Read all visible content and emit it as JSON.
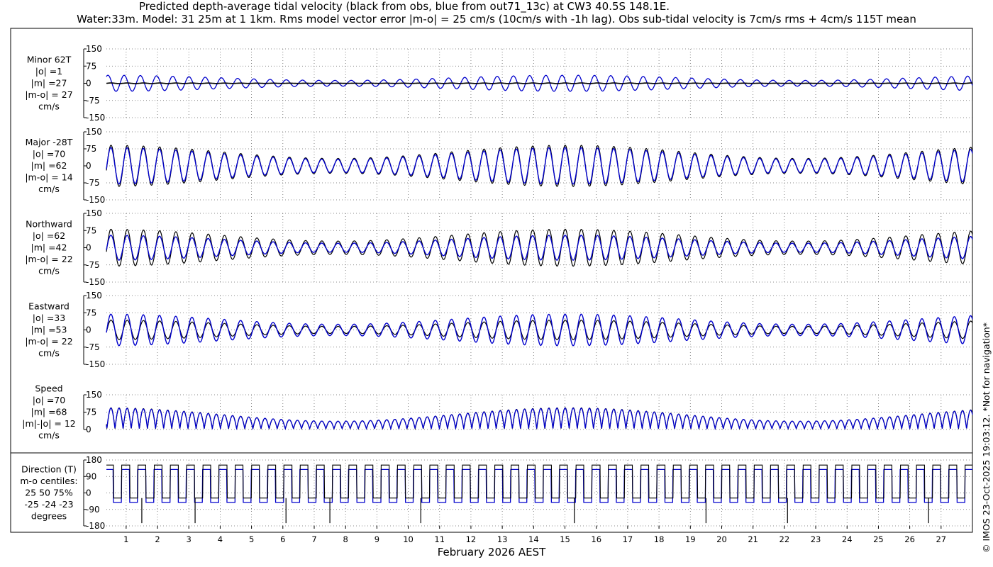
{
  "header": {
    "title_line1": "Predicted depth-average tidal velocity (black from obs, blue from out71_13c) at CW3 40.5S 148.1E.",
    "title_line2": "Water:33m. Model: 31 25m at 1 1km. Rms model vector error |m-o| = 25 cm/s (10cm/s with -1h lag). Obs sub-tidal velocity is 7cm/s rms + 4cm/s 115T mean"
  },
  "credit": "© IMOS 23-Oct-2025 19:03:12. *Not for navigation*",
  "colors": {
    "obs": "#000000",
    "model": "#0000cc"
  },
  "chart_data": {
    "type": "line",
    "xlabel": "February 2026 AEST",
    "x_ticks": [
      "1",
      "2",
      "3",
      "4",
      "5",
      "6",
      "7",
      "8",
      "9",
      "10",
      "11",
      "12",
      "13",
      "14",
      "15",
      "16",
      "17",
      "18",
      "19",
      "20",
      "21",
      "22",
      "23",
      "24",
      "25",
      "26",
      "27"
    ],
    "xlim": [
      0.37,
      28.0
    ],
    "grid": true,
    "series_legend": {
      "obs": "black from obs",
      "model": "blue from out71_13c"
    },
    "panels": [
      {
        "key": "minor",
        "label_lines": [
          "Minor 62T",
          "|o| =1",
          "|m| =27",
          "|m-o| = 27",
          "cm/s"
        ],
        "ylim": [
          -150,
          150
        ],
        "yticks": [
          "150",
          "75",
          "0",
          "-75",
          "-150"
        ],
        "ytick_values": [
          150,
          75,
          0,
          -75,
          -150
        ],
        "obs_amplitude": 1,
        "model_amplitude": 27
      },
      {
        "key": "major",
        "label_lines": [
          "Major -28T",
          "|o| =70",
          "|m| =62",
          "|m-o| = 14",
          "cm/s"
        ],
        "ylim": [
          -150,
          150
        ],
        "yticks": [
          "150",
          "75",
          "0",
          "-75",
          "-150"
        ],
        "ytick_values": [
          150,
          75,
          0,
          -75,
          -150
        ],
        "obs_amplitude": 70,
        "model_amplitude": 62
      },
      {
        "key": "north",
        "label_lines": [
          "Northward",
          "|o| =62",
          "|m| =42",
          "|m-o| = 22",
          "cm/s"
        ],
        "ylim": [
          -150,
          150
        ],
        "yticks": [
          "150",
          "75",
          "0",
          "-75",
          "-150"
        ],
        "ytick_values": [
          150,
          75,
          0,
          -75,
          -150
        ],
        "obs_amplitude": 62,
        "model_amplitude": 42
      },
      {
        "key": "east",
        "label_lines": [
          "Eastward",
          "|o| =33",
          "|m| =53",
          "|m-o| = 22",
          "cm/s"
        ],
        "ylim": [
          -150,
          150
        ],
        "yticks": [
          "150",
          "75",
          "0",
          "-75",
          "-150"
        ],
        "ytick_values": [
          150,
          75,
          0,
          -75,
          -150
        ],
        "obs_amplitude": 33,
        "model_amplitude": 53
      },
      {
        "key": "speed",
        "label_lines": [
          "Speed",
          "|o| =70",
          "|m| =68",
          "|m|-|o| = 12",
          "cm/s"
        ],
        "ylim": [
          0,
          150
        ],
        "yticks": [
          "150",
          "75",
          "0"
        ],
        "ytick_values": [
          150,
          75,
          0
        ],
        "obs_amplitude": 70,
        "model_amplitude": 68
      },
      {
        "key": "direction",
        "label_lines": [
          "Direction (T)",
          "m-o centiles:",
          "25  50  75%",
          "-25 -24 -23",
          "degrees"
        ],
        "ylim": [
          -180,
          180
        ],
        "yticks": [
          "180",
          "90",
          "0",
          "-90",
          "-180"
        ],
        "ytick_values": [
          180,
          90,
          0,
          -90,
          -180
        ],
        "obs_levels": [
          152,
          -28
        ],
        "model_levels": [
          128,
          -52
        ]
      }
    ]
  }
}
